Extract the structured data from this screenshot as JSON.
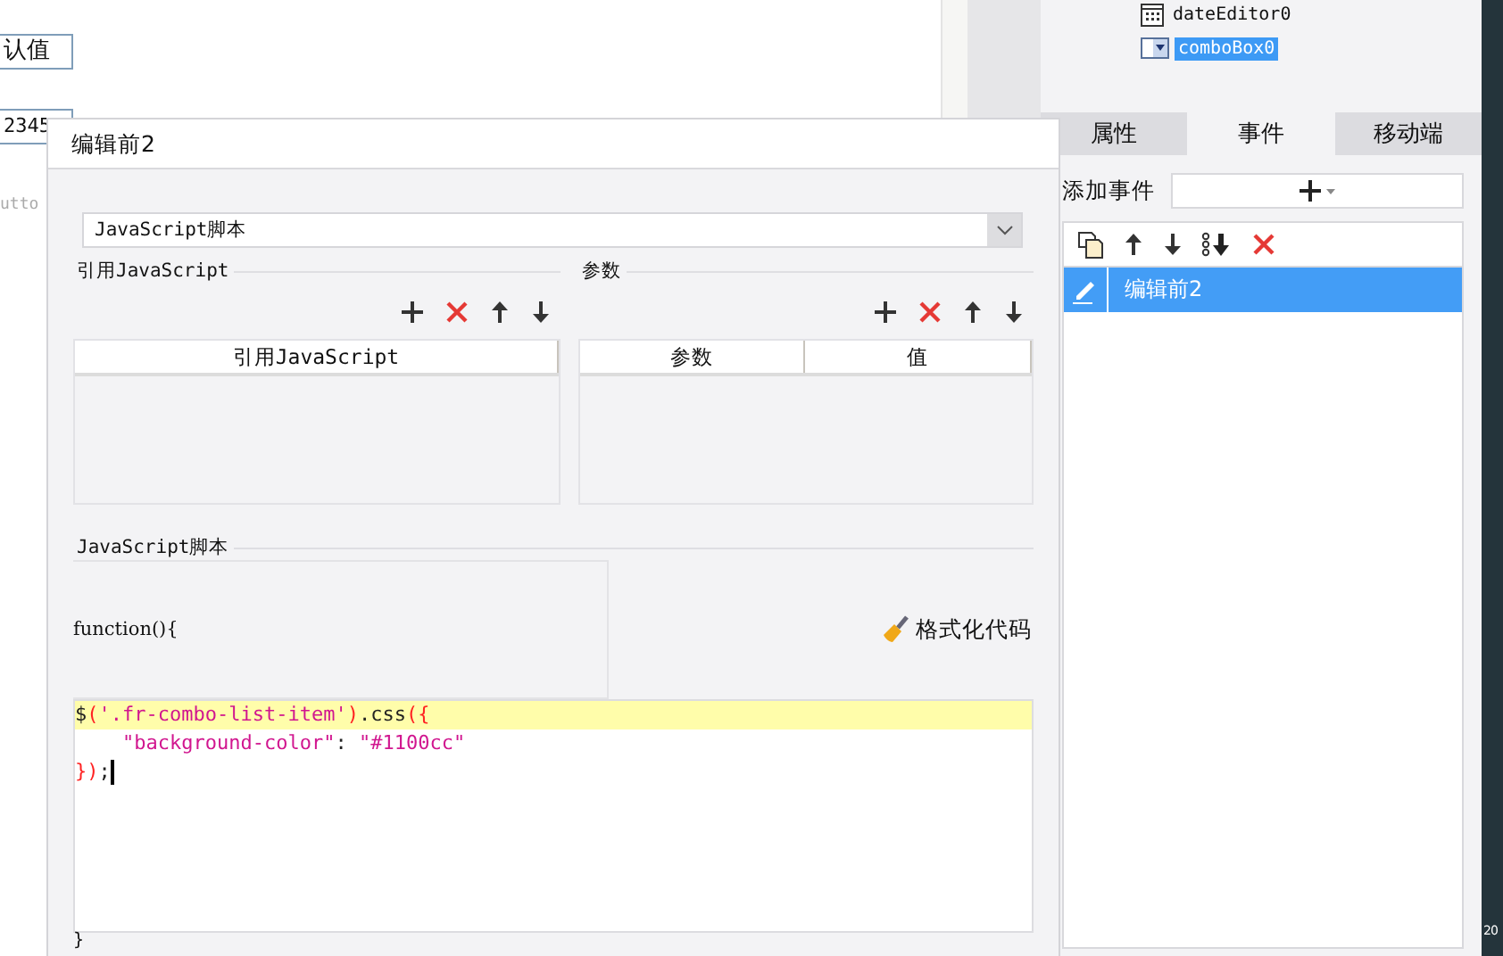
{
  "canvas": {
    "default_field": "认值",
    "number_field": "2345",
    "button_label": "utto"
  },
  "tree": {
    "items": [
      {
        "label": "dateEditor0",
        "kind": "date",
        "selected": false
      },
      {
        "label": "comboBox0",
        "kind": "combo",
        "selected": true
      }
    ]
  },
  "panel_tabs": [
    {
      "label": "属性",
      "selected": false
    },
    {
      "label": "事件",
      "selected": true
    },
    {
      "label": "移动端",
      "selected": false
    }
  ],
  "add_event": {
    "label": "添加事件"
  },
  "events": [
    {
      "label": "编辑前2",
      "selected": true
    }
  ],
  "dialog": {
    "title": "编辑前2",
    "type_select": "JavaScript脚本",
    "references": {
      "title": "引用JavaScript",
      "columns": [
        "引用JavaScript"
      ]
    },
    "params": {
      "title": "参数",
      "columns": [
        "参数",
        "值"
      ]
    },
    "script": {
      "title": "JavaScript脚本",
      "header": "function(){",
      "format_button": "格式化代码",
      "code": [
        {
          "text": "$('.fr-combo-list-item').css({",
          "highlighted": true,
          "caret": false
        },
        {
          "text": "    \"background-color\": \"#1100cc\"",
          "highlighted": false,
          "caret": false
        },
        {
          "text": "});",
          "highlighted": false,
          "caret": true
        }
      ],
      "footer": "}"
    }
  },
  "side_strip": {
    "text": "20"
  }
}
